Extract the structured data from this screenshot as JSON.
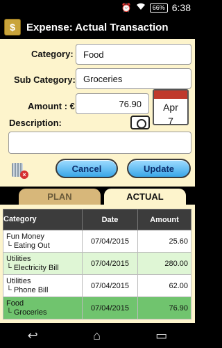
{
  "status": {
    "battery": "66%",
    "time": "6:38"
  },
  "appbar": {
    "icon_letter": "$",
    "title": "Expense: Actual Transaction"
  },
  "form": {
    "category_label": "Category:",
    "category_value": "Food",
    "subcategory_label": "Sub Category:",
    "subcategory_value": "Groceries",
    "amount_label": "Amount : €",
    "amount_value": "76.90",
    "date_month": "Apr",
    "date_day": "7",
    "description_label": "Description:",
    "description_value": "",
    "cancel_label": "Cancel",
    "update_label": "Update"
  },
  "tabs": {
    "plan": "PLAN",
    "actual": "ACTUAL"
  },
  "table": {
    "headers": {
      "category": "Category",
      "date": "Date",
      "amount": "Amount"
    },
    "rows": [
      {
        "cat": "Fun Money",
        "sub": "└ Eating Out",
        "date": "07/04/2015",
        "amount": "25.60"
      },
      {
        "cat": "Utilities",
        "sub": "└ Electricity Bill",
        "date": "07/04/2015",
        "amount": "280.00"
      },
      {
        "cat": "Utilities",
        "sub": "└ Phone Bill",
        "date": "07/04/2015",
        "amount": "62.00"
      },
      {
        "cat": "Food",
        "sub": "└ Groceries",
        "date": "07/04/2015",
        "amount": "76.90"
      }
    ]
  },
  "nav": {
    "back": "↩",
    "home": "⌂",
    "recents": "▭"
  }
}
